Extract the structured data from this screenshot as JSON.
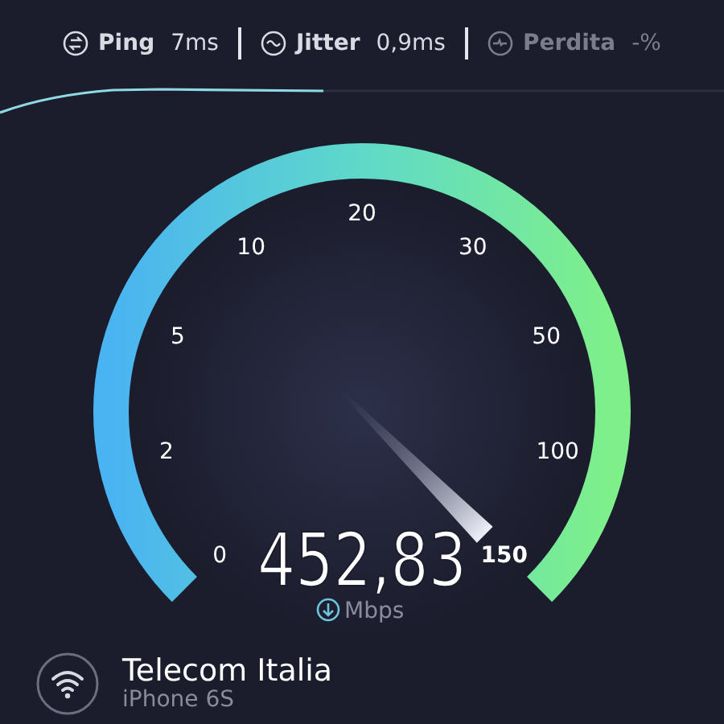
{
  "stats": [
    {
      "kind": "ping",
      "label": "Ping",
      "value": "7ms",
      "dimmed": false
    },
    {
      "kind": "jitter",
      "label": "Jitter",
      "value": "0,9ms",
      "dimmed": false
    },
    {
      "kind": "loss",
      "label": "Perdita",
      "value": "-%",
      "dimmed": true
    }
  ],
  "gauge": {
    "ticks": [
      "0",
      "2",
      "5",
      "10",
      "20",
      "30",
      "50",
      "100",
      "150"
    ],
    "value": "452,83",
    "unit": "Mbps"
  },
  "connection": {
    "provider": "Telecom Italia",
    "device": "iPhone 6S"
  }
}
